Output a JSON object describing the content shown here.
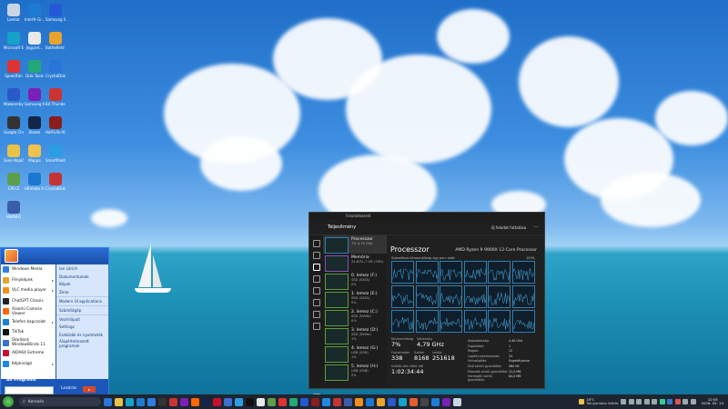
{
  "desktop": {
    "icons": [
      {
        "label": "Lomtár",
        "color": "#c9d6e3"
      },
      {
        "label": "Intel® Gr...",
        "color": "#1e7bd4"
      },
      {
        "label": "Samsung SmartSw...",
        "color": "#2458d6"
      },
      {
        "label": "Microsoft Edge",
        "color": "#16a2c8"
      },
      {
        "label": "Jegyzet...",
        "color": "#e9e9e9"
      },
      {
        "label": "Battlefield 4",
        "color": "#e8a42c"
      },
      {
        "label": "SpeedFan",
        "color": "#d33"
      },
      {
        "label": "Disk Tools",
        "color": "#21a876"
      },
      {
        "label": "CrystalDisk Mark",
        "color": "#2a74d9"
      },
      {
        "label": "Malwarebytes",
        "color": "#2a59c9"
      },
      {
        "label": "Samsung Magician",
        "color": "#7a1fb8"
      },
      {
        "label": "Bit Thunder",
        "color": "#c33"
      },
      {
        "label": "Google Chrome",
        "color": "#333"
      },
      {
        "label": "Steam",
        "color": "#13264a"
      },
      {
        "label": "Half-Life Alyx",
        "color": "#8b1d1d"
      },
      {
        "label": "Sven Naplók...",
        "color": "#e8c34a"
      },
      {
        "label": "Mappa",
        "color": "#f2c14e"
      },
      {
        "label": "SmartPaint",
        "color": "#2a9ee5"
      },
      {
        "label": "CPU-Z",
        "color": "#5c9e4a"
      },
      {
        "label": "Ultimate Fractals",
        "color": "#1a78d0"
      },
      {
        "label": "CrystalDisk Info",
        "color": "#c43434"
      },
      {
        "label": "HWiNFO",
        "color": "#3b5ca8"
      }
    ]
  },
  "start_menu": {
    "left_items": [
      {
        "label": "Windows Media",
        "color": "#2f7ee0",
        "arrow": false
      },
      {
        "label": "Fényképek",
        "color": "#e8a42c",
        "arrow": true
      },
      {
        "label": "VLC media player",
        "color": "#f39019",
        "arrow": true
      },
      {
        "label": "ChatGPT Classic",
        "color": "#222",
        "arrow": false
      },
      {
        "label": "Xiaomi Camera Viewer",
        "color": "#ff6a00",
        "arrow": false
      },
      {
        "label": "Telefon kapcsolat",
        "color": "#1c7ed6",
        "arrow": true
      },
      {
        "label": "TikTok",
        "color": "#111",
        "arrow": false
      },
      {
        "label": "Stardock WindowBlinds 11",
        "color": "#3b6fd1",
        "arrow": false
      },
      {
        "label": "AIDA64 Extreme",
        "color": "#c8102e",
        "arrow": false
      },
      {
        "label": "Képkivágó",
        "color": "#1f88e5",
        "arrow": true
      }
    ],
    "right_items": [
      {
        "label": "Ian Lőrich",
        "sep": false
      },
      {
        "label": "Dokumentumok",
        "sep": false
      },
      {
        "label": "Képek",
        "sep": false
      },
      {
        "label": "Zene",
        "sep": false
      },
      {
        "label": "Modern UI applications",
        "sep": true
      },
      {
        "label": "Számítógép",
        "sep": true
      },
      {
        "label": "Vezérlőpult",
        "sep": true
      },
      {
        "label": "Settings",
        "sep": false
      },
      {
        "label": "Eszközök és nyomtatók",
        "sep": false
      },
      {
        "label": "Alapértelmezett programok",
        "sep": false
      }
    ],
    "all_programs": "All Programs",
    "logoff": "Lezárás",
    "power": "▸"
  },
  "task_manager": {
    "window_title": "Feladatkezelő",
    "section": "Teljesítmény",
    "new_task": "Új feladat futtatása",
    "more": "···",
    "list": [
      {
        "name": "Processzor",
        "sub": "7% 4,79 GHz",
        "selected": true
      },
      {
        "name": "Memória",
        "sub": "24,6/31,7 GB (78%)",
        "selected": false
      },
      {
        "name": "0. lemez (F:)",
        "sub": "SSD (SATA)",
        "sub2": "0%",
        "selected": false
      },
      {
        "name": "1. lemez (E:)",
        "sub": "SSD (SATA)",
        "sub2": "0%",
        "selected": false
      },
      {
        "name": "2. lemez (C:)",
        "sub": "SSD (NVMe)",
        "sub2": "0%",
        "selected": false
      },
      {
        "name": "3. lemez (D:)",
        "sub": "SSD (NVMe)",
        "sub2": "1%",
        "selected": false
      },
      {
        "name": "4. lemez (G:)",
        "sub": "USB (USB)",
        "sub2": "1%",
        "selected": false
      },
      {
        "name": "5. lemez (H:)",
        "sub": "USB (USB)",
        "sub2": "0%",
        "selected": false
      }
    ],
    "cpu_title": "Processzor",
    "cpu_model": "AMD Ryzen 9 9900X 12-Core Processor",
    "graph_caption": "Százalékos kihasználtság egy perc alatt",
    "graph_max": "100%",
    "stats": {
      "util_label": "Kihasználtság",
      "util_value": "7%",
      "speed_label": "Sebesség",
      "speed_value": "4,79 GHz",
      "proc_label": "Folyamatok",
      "proc_value": "338",
      "threads_label": "Szálak",
      "threads_value": "8168",
      "handles_label": "Leírók",
      "handles_value": "251618",
      "uptime_label": "Indítás óta eltelt idő",
      "uptime_value": "1:02:34:44"
    },
    "details": [
      {
        "k": "Alapsebesség:",
        "v": "4,40 GHz"
      },
      {
        "k": "Foglalatok:",
        "v": "1"
      },
      {
        "k": "Magok:",
        "v": "12"
      },
      {
        "k": "Logikai processzorok:",
        "v": "24"
      },
      {
        "k": "Virtualizálás:",
        "v": "Engedélyezve"
      },
      {
        "k": "Első szintű gyorsítótár:",
        "v": "960 kB"
      },
      {
        "k": "Második szintű gyorsítótár:",
        "v": "12,0 MB"
      },
      {
        "k": "Harmadik szintű gyorsítótár:",
        "v": "64,0 MB"
      }
    ]
  },
  "taskbar": {
    "search_placeholder": "Keresés",
    "weather": "18°C",
    "weather_sub": "Túlnyomóan felhős",
    "time": "12:05",
    "date": "2026. 05. 13."
  }
}
